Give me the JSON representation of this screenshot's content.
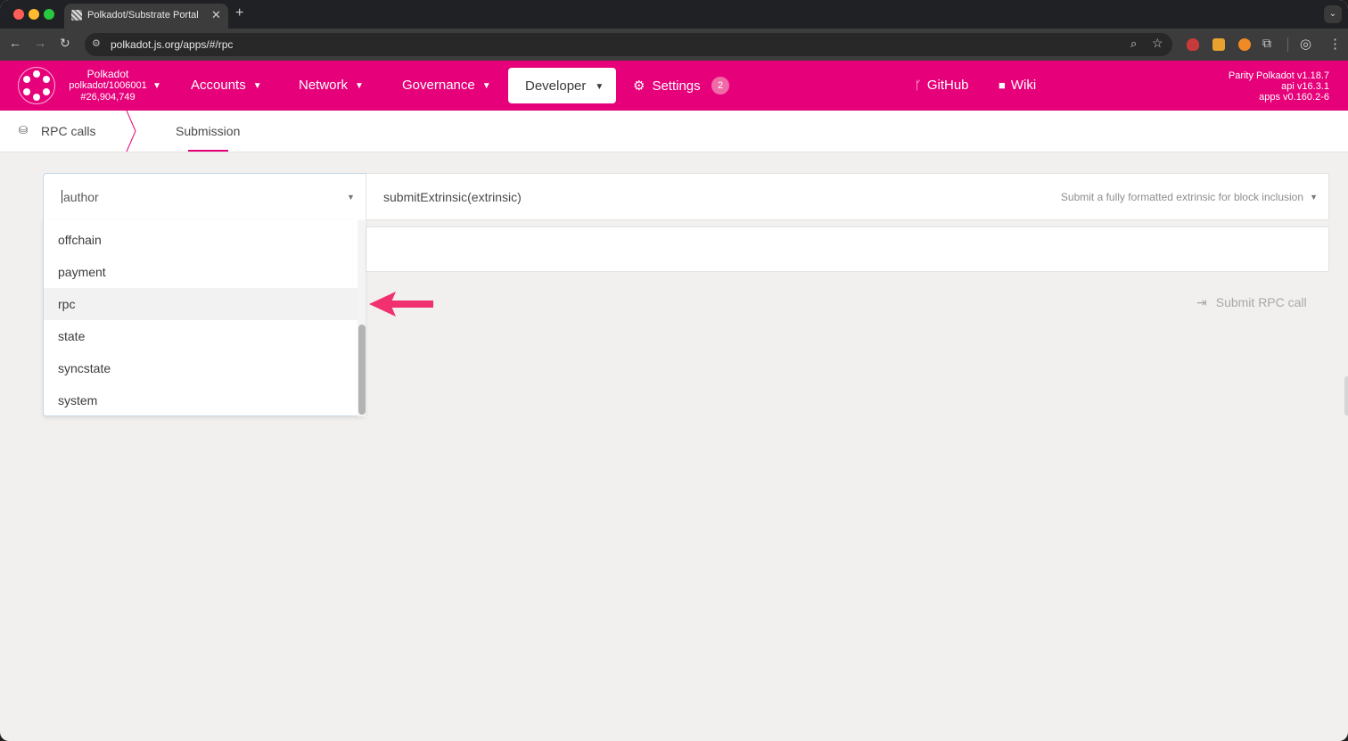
{
  "browser": {
    "tab_title": "Polkadot/Substrate Portal",
    "url": "polkadot.js.org/apps/#/rpc",
    "icons": [
      "back-icon",
      "forward-icon",
      "reload-icon",
      "site-settings-icon",
      "zoom-icon",
      "star-icon",
      "extensions-icon",
      "profile-icon",
      "menu-icon"
    ]
  },
  "chain": {
    "name": "Polkadot",
    "spec": "polkadot/1006001",
    "block": "#26,904,749"
  },
  "nav": {
    "accounts": "Accounts",
    "network": "Network",
    "governance": "Governance",
    "developer": "Developer",
    "settings": "Settings",
    "settings_badge": "2",
    "github": "GitHub",
    "wiki": "Wiki"
  },
  "versions": {
    "node": "Parity Polkadot v1.18.7",
    "api": "api v16.3.1",
    "apps": "apps v0.160.2-6"
  },
  "subnav": {
    "title": "RPC calls",
    "tab": "Submission"
  },
  "form": {
    "section_value": "author",
    "method_name": "submitExtrinsic(extrinsic)",
    "method_description": "Submit a fully formatted extrinsic for block inclusion",
    "submit_label": "Submit RPC call"
  },
  "dropdown": {
    "options": [
      "offchain",
      "payment",
      "rpc",
      "state",
      "syncstate",
      "system"
    ],
    "highlighted": "rpc"
  },
  "colors": {
    "brand": "#e6007a",
    "annotation_arrow": "#f0306f"
  }
}
